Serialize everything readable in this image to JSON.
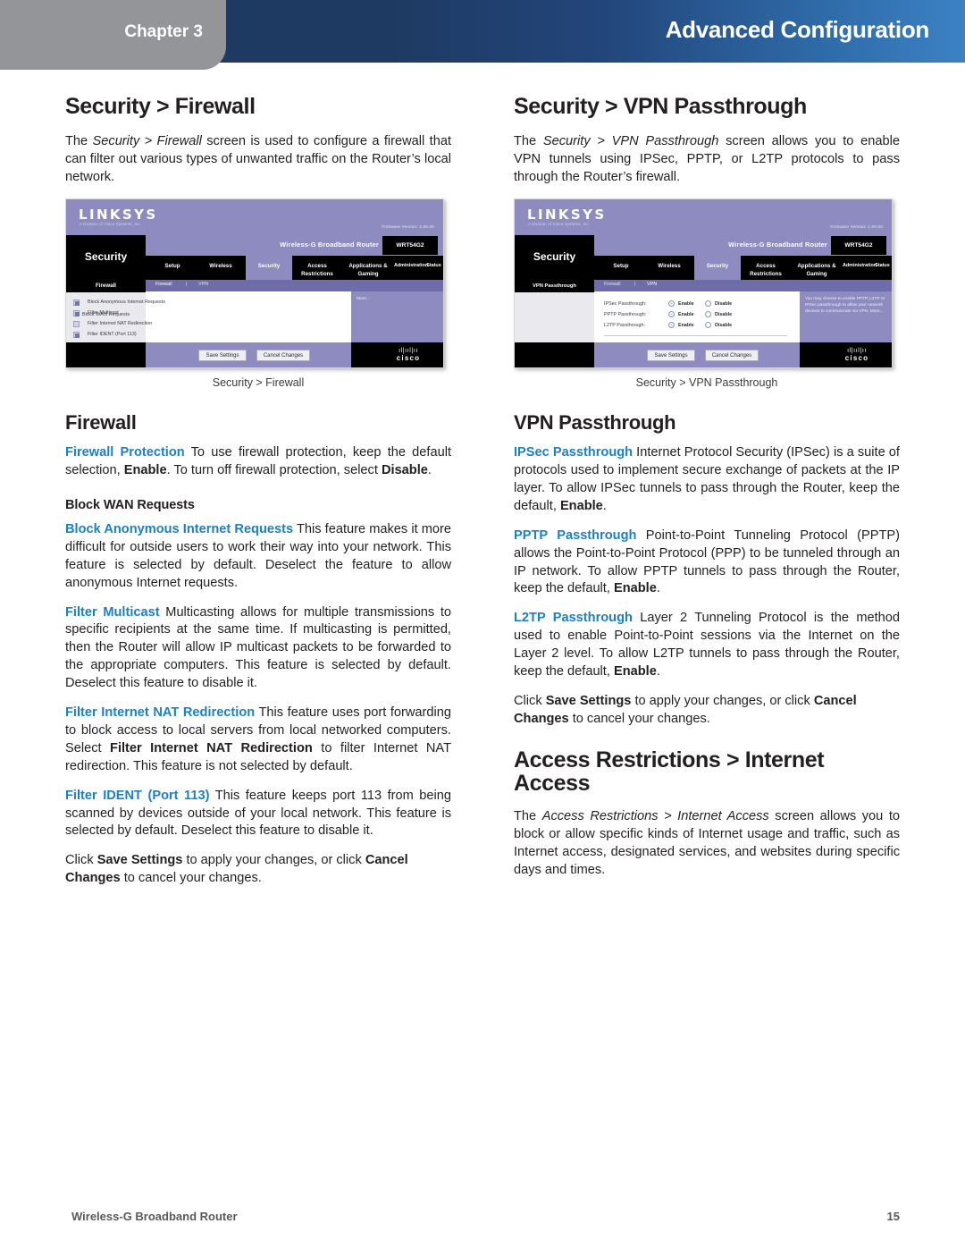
{
  "header": {
    "chapter_label": "Chapter 3",
    "title": "Advanced Configuration"
  },
  "footer": {
    "product": "Wireless-G Broadband Router",
    "page_number": "15"
  },
  "left_column": {
    "heading": "Security > Firewall",
    "intro": {
      "p1_a": "The ",
      "p1_it": "Security > Firewall",
      "p1_b": " screen is used to configure a firewall that can filter out various types of unwanted traffic on the Router’s local network."
    },
    "figure_caption": "Security > Firewall",
    "firewall_heading": "Firewall",
    "firewall_protection": {
      "term": "Firewall Protection",
      "t1": "  To use firewall protection, keep the default selection, ",
      "b1": "Enable",
      "t2": ". To turn off firewall protection, select ",
      "b2": "Disable",
      "t3": "."
    },
    "block_wan_heading": "Block WAN Requests",
    "block_anonymous": {
      "term": "Block Anonymous Internet Requests",
      "text": " This feature makes it more difficult for outside users to work their way into your network. This feature is selected by default. Deselect the feature to allow anonymous Internet requests."
    },
    "filter_multicast": {
      "term": "Filter Multicast",
      "text": " Multicasting allows for multiple transmissions to specific recipients at the same time. If multicasting is permitted, then the Router will allow IP multicast packets to be forwarded to the appropriate computers. This feature is selected by default. Deselect this feature to disable it."
    },
    "filter_nat": {
      "term": "Filter Internet NAT Redirection",
      "t1": " This feature uses port forwarding to block access to local servers from local networked computers. Select ",
      "b1": "Filter Internet NAT Redirection",
      "t2": " to filter Internet NAT redirection. This feature is not selected by default."
    },
    "filter_ident": {
      "term": "Filter IDENT (Port 113)",
      "text": "  This feature keeps port 113 from being scanned by devices outside of your local network. This feature is selected by default. Deselect this feature to disable it."
    },
    "save_note": {
      "t1": "Click ",
      "b1": "Save Settings",
      "t2": " to apply your changes, or click ",
      "b2": "Cancel Changes",
      "t3": " to cancel your changes."
    }
  },
  "right_column": {
    "heading": "Security > VPN Passthrough",
    "intro": {
      "p1_a": "The ",
      "p1_it": "Security > VPN Passthrough",
      "p1_b": " screen allows you to enable VPN tunnels using IPSec, PPTP, or L2TP protocols to pass through the Router’s firewall."
    },
    "figure_caption": "Security > VPN Passthrough",
    "vpn_heading": "VPN Passthrough",
    "ipsec": {
      "term": "IPSec Passthrough",
      "t1": "  Internet Protocol Security (IPSec) is a suite of protocols used to implement secure exchange of packets at the IP layer. To allow IPSec tunnels to pass through the Router, keep the default, ",
      "b1": "Enable",
      "t2": "."
    },
    "pptp": {
      "term": "PPTP Passthrough",
      "t1": " Point-to-Point Tunneling Protocol (PPTP) allows the Point-to-Point Protocol (PPP) to be tunneled through an IP network. To allow PPTP tunnels to pass through the Router, keep the default, ",
      "b1": "Enable",
      "t2": "."
    },
    "l2tp": {
      "term": "L2TP Passthrough",
      "t1": " Layer 2 Tunneling Protocol is the method used to enable Point-to-Point sessions via the Internet on the Layer 2 level. To allow L2TP tunnels to pass through the Router, keep the default, ",
      "b1": "Enable",
      "t2": "."
    },
    "save_note": {
      "t1": "Click ",
      "b1": "Save Settings",
      "t2": " to apply your changes, or click ",
      "b2": "Cancel Changes",
      "t3": " to cancel your changes."
    },
    "access_heading": "Access Restrictions > Internet Access",
    "access_intro": {
      "p1_a": "The ",
      "p1_it": "Access Restrictions > Internet Access",
      "p1_b": " screen allows you to block or allow specific kinds of Internet usage and traffic, such as Internet access, designated services, and websites during specific days and times."
    }
  },
  "firewall_screenshot": {
    "brand": "LINKSYS",
    "brand_sub": "A Division of Cisco Systems, Inc.",
    "firmware": "Firmware Version: 1.00.00",
    "model_name": "Wireless-G Broadband Router",
    "model_number": "WRT54G2",
    "section": "Security",
    "tabs": [
      "Setup",
      "Wireless",
      "Security",
      "Access Restrictions",
      "Applications & Gaming",
      "Administration",
      "Status"
    ],
    "active_tab": "Security",
    "subtabs": [
      "Firewall",
      "|",
      "VPN"
    ],
    "panel_title": "Firewall",
    "panel_label": "Block WAN Requests",
    "checkboxes": [
      {
        "label": "Block Anonymous Internet Requests",
        "checked": true
      },
      {
        "label": "Filter Multicast",
        "checked": true
      },
      {
        "label": "Filter Internet NAT Redirection",
        "checked": false
      },
      {
        "label": "Filter IDENT (Port 113)",
        "checked": true
      }
    ],
    "help_text": "More...",
    "save_button": "Save Settings",
    "cancel_button": "Cancel Changes",
    "cisco_word": "cisco"
  },
  "vpn_screenshot": {
    "brand": "LINKSYS",
    "brand_sub": "A Division of Cisco Systems, Inc.",
    "firmware": "Firmware Version: 1.00.00",
    "model_name": "Wireless-G Broadband Router",
    "model_number": "WRT54G2",
    "section": "Security",
    "tabs": [
      "Setup",
      "Wireless",
      "Security",
      "Access Restrictions",
      "Applications & Gaming",
      "Administration",
      "Status"
    ],
    "active_tab": "Security",
    "subtabs": [
      "Firewall",
      "|",
      "VPN"
    ],
    "panel_title": "VPN Passthrough",
    "rows": [
      {
        "label": "IPSec Passthrough:",
        "enable": "Enable",
        "disable": "Disable",
        "selected": "Enable"
      },
      {
        "label": "PPTP Passthrough:",
        "enable": "Enable",
        "disable": "Disable",
        "selected": "Enable"
      },
      {
        "label": "L2TP Passthrough:",
        "enable": "Enable",
        "disable": "Disable",
        "selected": "Enable"
      }
    ],
    "help_text": "You may choose to enable PPTP, L2TP or IPSec passthrough to allow your network devices to communicate via VPN. More...",
    "save_button": "Save Settings",
    "cancel_button": "Cancel Changes",
    "cisco_word": "cisco"
  }
}
